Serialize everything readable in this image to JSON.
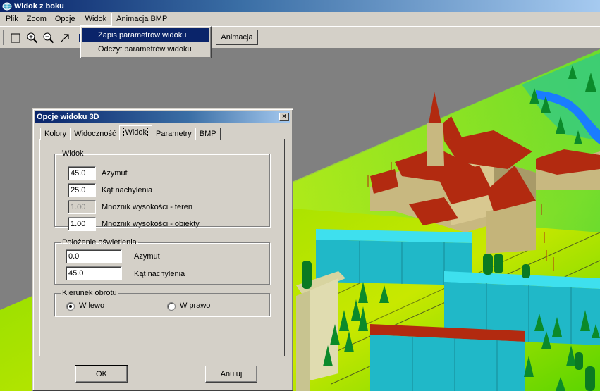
{
  "window": {
    "title": "Widok z boku"
  },
  "menubar": {
    "items": [
      "Plik",
      "Zoom",
      "Opcje",
      "Widok",
      "Animacja BMP"
    ]
  },
  "toolbar": {
    "animation_button": "Animacja"
  },
  "dropdown": {
    "items": [
      "Zapis parametrów widoku",
      "Odczyt parametrów widoku"
    ]
  },
  "dialog": {
    "title": "Opcje widoku 3D",
    "close_glyph": "×",
    "tabs": [
      "Kolory",
      "Widoczność",
      "Widok",
      "Parametry",
      "BMP"
    ],
    "widok_group": {
      "legend": "Widok",
      "rows": [
        {
          "value": "45.0",
          "label": "Azymut"
        },
        {
          "value": "25.0",
          "label": "Kąt nachylenia"
        },
        {
          "value": "1.00",
          "label": "Mnożnik wysokości - teren",
          "disabled": true
        },
        {
          "value": "1.00",
          "label": "Mnożnik wysokości - obiekty"
        }
      ]
    },
    "light_group": {
      "legend": "Położenie oświetlenia",
      "rows": [
        {
          "value": "0.0",
          "label": "Azymut"
        },
        {
          "value": "45.0",
          "label": "Kąt nachylenia"
        }
      ]
    },
    "rotation_group": {
      "legend": "Kierunek obrotu",
      "left": "W lewo",
      "right": "W prawo",
      "selected": "W lewo"
    },
    "ok": "OK",
    "cancel": "Anuluj"
  },
  "colors": {
    "titlebar": "#0a246a",
    "face": "#d4d0c8",
    "highlight": "#0a246a",
    "terrain": "#7fd400",
    "roof": "#b22a10",
    "block": "#20b8c8",
    "tree": "#0b8a2a"
  }
}
